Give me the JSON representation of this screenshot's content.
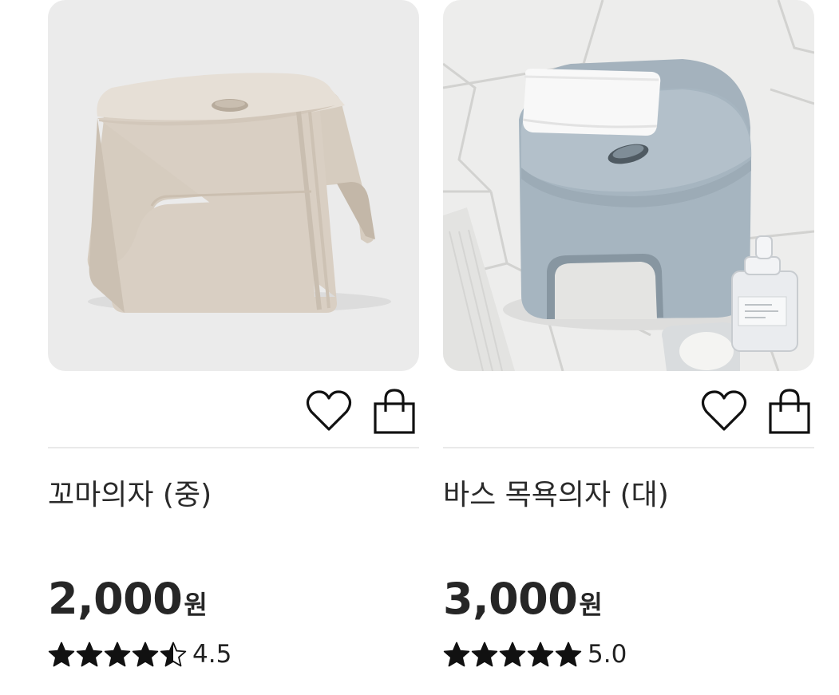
{
  "products": [
    {
      "name": "꼬마의자 (중)",
      "price": "2,000",
      "currency": "원",
      "rating_value": 4.5,
      "rating_text": "4.5",
      "image": "beige-plastic-stool",
      "icons": {
        "wishlist": "heart-outline-icon",
        "cart": "shopping-bag-icon"
      }
    },
    {
      "name": "바스 목욕의자 (대)",
      "price": "3,000",
      "currency": "원",
      "rating_value": 5.0,
      "rating_text": "5.0",
      "image": "gray-bath-stool",
      "icons": {
        "wishlist": "heart-outline-icon",
        "cart": "shopping-bag-icon"
      }
    }
  ],
  "colors": {
    "text": "#222222",
    "divider": "#e9e9e9",
    "star": "#111111"
  }
}
